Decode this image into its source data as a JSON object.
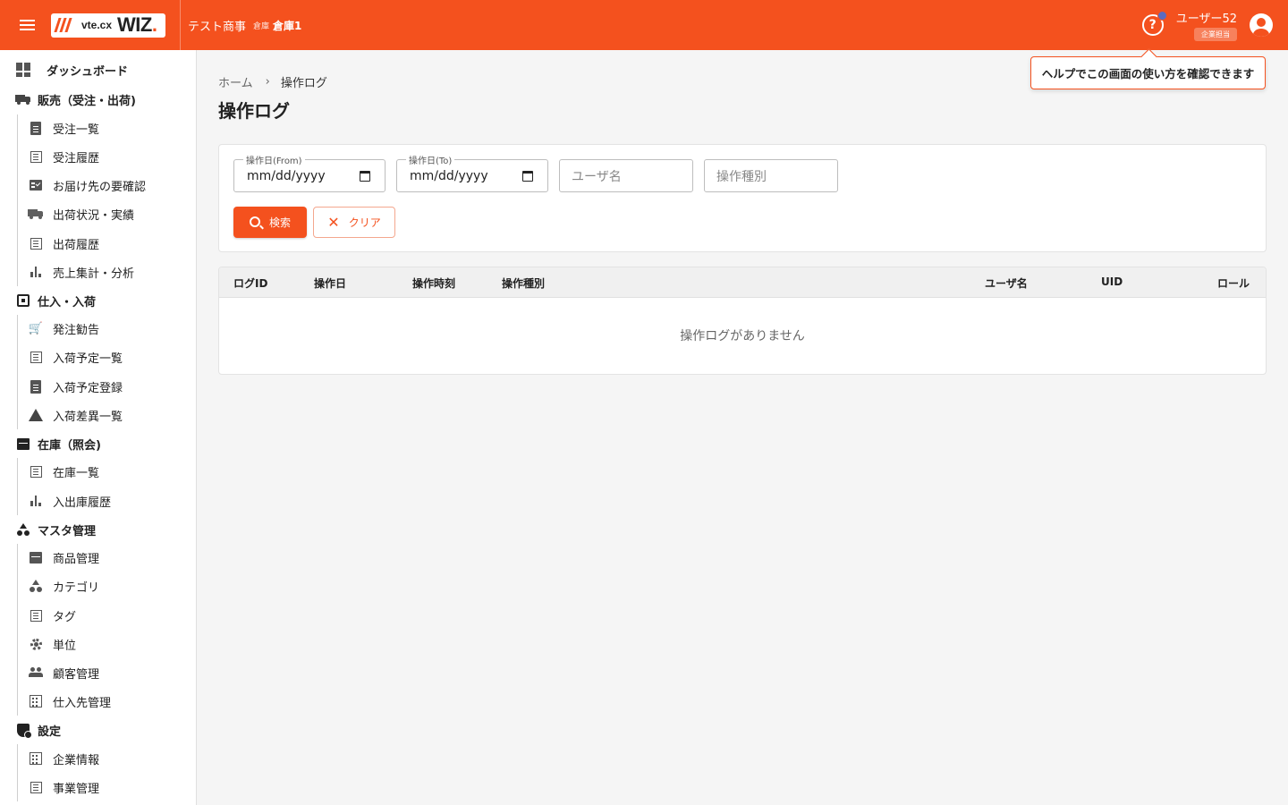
{
  "header": {
    "logo_text": "vte.cx",
    "logo_brand": "WIZ",
    "company": "テスト商事",
    "warehouse_label": "倉庫",
    "warehouse_name": "倉庫1",
    "user_name": "ユーザー52",
    "user_role": "企業担当",
    "accent_color": "#f4511e"
  },
  "tooltip": {
    "text": "ヘルプでこの画面の使い方を確認できます"
  },
  "sidebar": {
    "dashboard": "ダッシュボード",
    "sections": [
      {
        "label": "販売（受注・出荷)",
        "icon": "truck-icon",
        "items": [
          {
            "label": "受注一覧",
            "icon": "clipboard-icon"
          },
          {
            "label": "受注履歴",
            "icon": "list-icon"
          },
          {
            "label": "お届け先の要確認",
            "icon": "checklist-icon"
          },
          {
            "label": "出荷状況・実績",
            "icon": "truck-icon"
          },
          {
            "label": "出荷履歴",
            "icon": "list-icon"
          },
          {
            "label": "売上集計・分析",
            "icon": "bar-chart-icon"
          }
        ]
      },
      {
        "label": "仕入・入荷",
        "icon": "inbox-icon",
        "items": [
          {
            "label": "発注勧告",
            "icon": "cart-icon"
          },
          {
            "label": "入荷予定一覧",
            "icon": "list-icon"
          },
          {
            "label": "入荷予定登録",
            "icon": "clipboard-icon"
          },
          {
            "label": "入荷差異一覧",
            "icon": "warning-icon"
          }
        ]
      },
      {
        "label": "在庫（照会)",
        "icon": "archive-icon",
        "items": [
          {
            "label": "在庫一覧",
            "icon": "list-icon"
          },
          {
            "label": "入出庫履歴",
            "icon": "bar-chart-icon"
          }
        ]
      },
      {
        "label": "マスタ管理",
        "icon": "shapes-icon",
        "items": [
          {
            "label": "商品管理",
            "icon": "archive-icon"
          },
          {
            "label": "カテゴリ",
            "icon": "shapes-icon"
          },
          {
            "label": "タグ",
            "icon": "list-icon"
          },
          {
            "label": "単位",
            "icon": "gear-icon"
          },
          {
            "label": "顧客管理",
            "icon": "people-icon"
          },
          {
            "label": "仕入先管理",
            "icon": "building-icon"
          }
        ]
      },
      {
        "label": "設定",
        "icon": "shield-icon",
        "items": [
          {
            "label": "企業情報",
            "icon": "building-icon"
          },
          {
            "label": "事業管理",
            "icon": "list-icon"
          }
        ]
      }
    ]
  },
  "breadcrumb": {
    "home": "ホーム",
    "current": "操作ログ"
  },
  "page": {
    "title": "操作ログ"
  },
  "filters": {
    "date_from_label": "操作日(From)",
    "date_from_value": "mm/dd/yyyy",
    "date_to_label": "操作日(To)",
    "date_to_value": "mm/dd/yyyy",
    "username_placeholder": "ユーザ名",
    "op_type_placeholder": "操作種別",
    "search_label": "検索",
    "clear_label": "クリア"
  },
  "table": {
    "columns": [
      "ログID",
      "操作日",
      "操作時刻",
      "操作種別",
      "ユーザ名",
      "UID",
      "ロール"
    ],
    "empty_message": "操作ログがありません"
  }
}
